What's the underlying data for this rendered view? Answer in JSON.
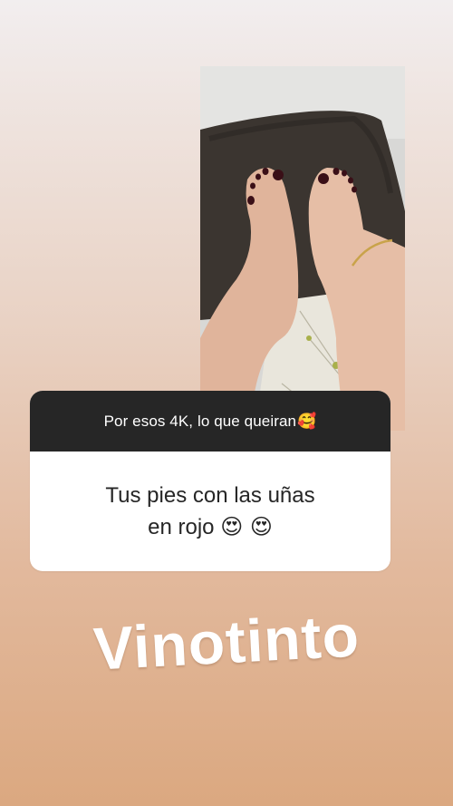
{
  "question": {
    "prompt": "Por esos 4K, lo que queiran",
    "prompt_emoji": "🥰",
    "answer_line1": "Tus pies con las uñas",
    "answer_line2": "en rojo",
    "answer_emojis": "😍 😍"
  },
  "caption": {
    "text": "Vinotinto"
  },
  "colors": {
    "header_bg": "#262626",
    "card_bg": "#ffffff",
    "gradient_top": "#f2eeef",
    "gradient_bottom": "#dba880"
  }
}
